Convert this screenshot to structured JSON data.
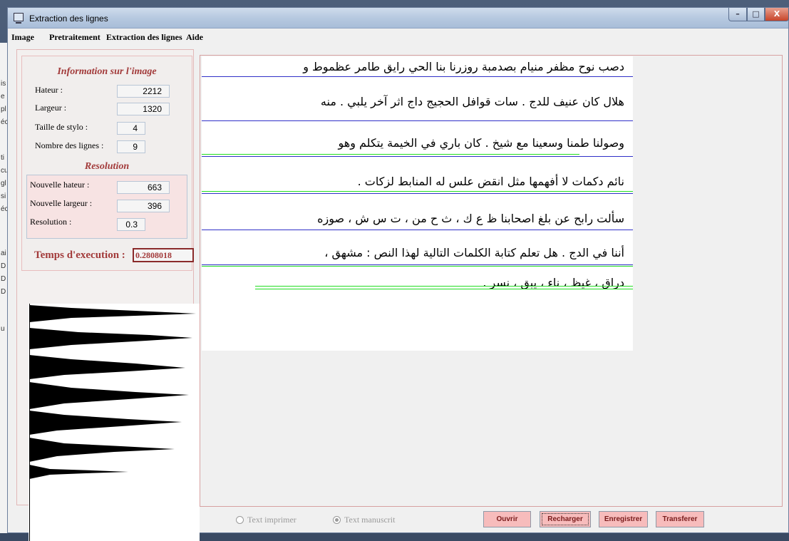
{
  "window": {
    "title": "Extraction des lignes",
    "min_glyph": "–",
    "max_glyph": "□",
    "close_glyph": "X"
  },
  "menu": [
    "Image",
    "Pretraitement",
    "Extraction des lignes",
    "Aide"
  ],
  "info": {
    "title": "Information sur l'image",
    "height_label": "Hateur :",
    "height_value": "2212",
    "width_label": "Largeur :",
    "width_value": "1320",
    "pen_label": "Taille de stylo :",
    "pen_value": "4",
    "lines_label": "Nombre des lignes :",
    "lines_value": "9"
  },
  "resolution": {
    "title": "Resolution",
    "new_height_label": "Nouvelle hateur :",
    "new_height_value": "663",
    "new_width_label": "Nouvelle largeur :",
    "new_width_value": "396",
    "resolution_label": "Resolution :",
    "resolution_value": "0.3"
  },
  "timing": {
    "label": "Temps d'execution :",
    "value": "0.2808018"
  },
  "document_lines": [
    "دصب نوح مظفر منيام بصدمبة روزرنا بنا الحي رايق طامر عظموط و",
    "هلال كان عنيف للدج . سات قوافل الحجيج داج اثر آخر يلبي . منه",
    "وصولنا طمنا وسعينا مع شيخ . كان باري في الخيمة يتكلم وهو",
    "نائم دكمات لا أفهمها مثل انقض علس له المنابط لزكات .",
    "سألت رابح عن بلغ اصحابنا ظ ع ك ، ث ح من ، ت س ش ، صوزه",
    "أننا في الدج . هل تعلم كتابة الكلمات التالية لهذا النص : مشهق ،",
    "دراق ، غيظ ، ناء ، يبق ، نسر ."
  ],
  "guide_colors": {
    "blue": "#3030c8",
    "green": "#22dd22"
  },
  "options": {
    "printed": "Text imprimer",
    "handwritten": "Text manuscrit",
    "selected": "handwritten"
  },
  "buttons": {
    "open": "Ouvrir",
    "reload": "Recharger",
    "save": "Enregistrer",
    "transfer": "Transferer"
  },
  "left_edge_letters": [
    "is",
    "e",
    "pl",
    "éc",
    "ti",
    "cu",
    "gl",
    "si",
    "éc",
    "ai",
    "D",
    "D",
    "D",
    "u"
  ]
}
